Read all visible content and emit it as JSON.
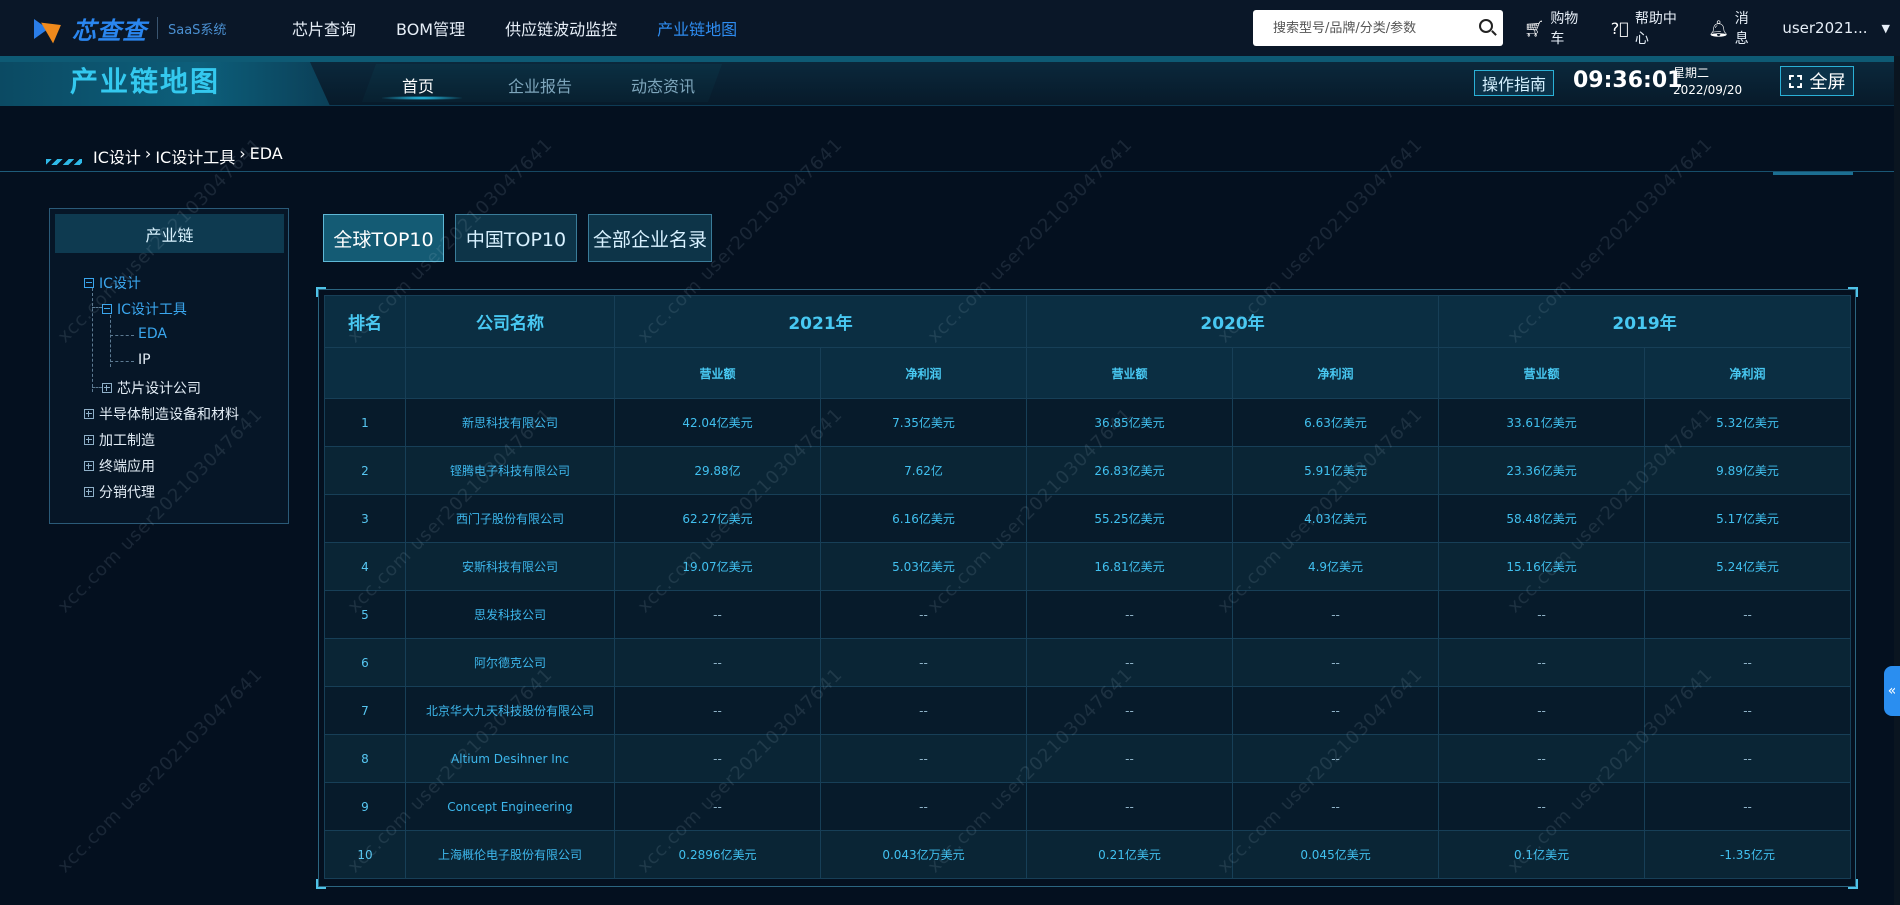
{
  "app": {
    "logo_text": "芯查查",
    "logo_sub": "SaaS系统"
  },
  "menu": [
    {
      "label": "芯片查询",
      "active": false
    },
    {
      "label": "BOM管理",
      "active": false
    },
    {
      "label": "供应链波动监控",
      "active": false
    },
    {
      "label": "产业链地图",
      "active": true
    }
  ],
  "search": {
    "placeholder": "搜索型号/品牌/分类/参数",
    "value": ""
  },
  "toolbar": {
    "cart": "购物车",
    "help": "帮助中心",
    "messages": "消息",
    "user": "user2021..."
  },
  "banner": {
    "title": "产业链地图",
    "tabs": [
      {
        "label": "首页",
        "active": true
      },
      {
        "label": "企业报告",
        "active": false
      },
      {
        "label": "动态资讯",
        "active": false
      }
    ],
    "guide": "操作指南",
    "time": "09:36:01",
    "weekday": "星期二",
    "date": "2022/09/20",
    "fullscreen": "全屏"
  },
  "breadcrumb": [
    "IC设计",
    "IC设计工具",
    "EDA"
  ],
  "tree": {
    "title": "产业链",
    "nodes": {
      "ic_design": "IC设计",
      "ic_tools": "IC设计工具",
      "eda": "EDA",
      "ip": "IP",
      "chip_co": "芯片设计公司",
      "semi": "半导体制造设备和材料",
      "manufacture": "加工制造",
      "terminal": "终端应用",
      "distribution": "分销代理"
    }
  },
  "tabs": [
    {
      "label": "全球TOP10",
      "active": true
    },
    {
      "label": "中国TOP10",
      "active": false
    },
    {
      "label": "全部企业名录",
      "active": false
    }
  ],
  "table": {
    "headers": {
      "rank": "排名",
      "company": "公司名称",
      "years": [
        "2021年",
        "2020年",
        "2019年"
      ],
      "revenue": "营业额",
      "profit": "净利润"
    },
    "rows": [
      {
        "rank": "1",
        "name": "新思科技有限公司",
        "cells": [
          "42.04亿美元",
          "7.35亿美元",
          "36.85亿美元",
          "6.63亿美元",
          "33.61亿美元",
          "5.32亿美元"
        ]
      },
      {
        "rank": "2",
        "name": "铿腾电子科技有限公司",
        "cells": [
          "29.88亿",
          "7.62亿",
          "26.83亿美元",
          "5.91亿美元",
          "23.36亿美元",
          "9.89亿美元"
        ]
      },
      {
        "rank": "3",
        "name": "西门子股份有限公司",
        "cells": [
          "62.27亿美元",
          "6.16亿美元",
          "55.25亿美元",
          "4.03亿美元",
          "58.48亿美元",
          "5.17亿美元"
        ]
      },
      {
        "rank": "4",
        "name": "安斯科技有限公司",
        "cells": [
          "19.07亿美元",
          "5.03亿美元",
          "16.81亿美元",
          "4.9亿美元",
          "15.16亿美元",
          "5.24亿美元"
        ]
      },
      {
        "rank": "5",
        "name": "思发科技公司",
        "cells": [
          "--",
          "--",
          "--",
          "--",
          "--",
          "--"
        ]
      },
      {
        "rank": "6",
        "name": "阿尔德克公司",
        "cells": [
          "--",
          "--",
          "--",
          "--",
          "--",
          "--"
        ]
      },
      {
        "rank": "7",
        "name": "北京华大九天科技股份有限公司",
        "cells": [
          "--",
          "--",
          "--",
          "--",
          "--",
          "--"
        ]
      },
      {
        "rank": "8",
        "name": "Altium Desihner Inc",
        "cells": [
          "--",
          "--",
          "--",
          "--",
          "--",
          "--"
        ]
      },
      {
        "rank": "9",
        "name": "Concept Engineering",
        "cells": [
          "--",
          "--",
          "--",
          "--",
          "--",
          "--"
        ]
      },
      {
        "rank": "10",
        "name": "上海概伦电子股份有限公司",
        "cells": [
          "0.2896亿美元",
          "0.043亿万美元",
          "0.21亿美元",
          "0.045亿美元",
          "0.1亿美元",
          "-1.35亿元"
        ]
      }
    ]
  },
  "watermark": "xcc.com user202103047641",
  "float_btn": "«"
}
